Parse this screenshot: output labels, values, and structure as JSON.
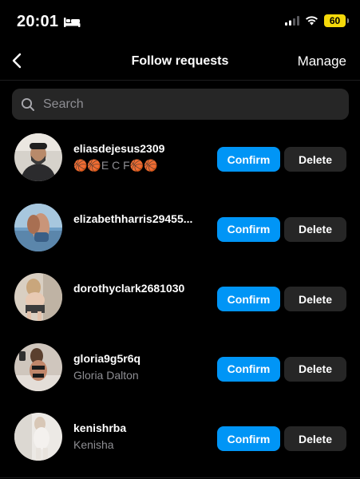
{
  "status_bar": {
    "time": "20:01",
    "battery_level": "60",
    "icons": [
      "bed-icon",
      "signal-icon",
      "wifi-icon",
      "battery-icon"
    ],
    "battery_color": "#f5d90a"
  },
  "header": {
    "back_icon": "chevron-left-icon",
    "title": "Follow requests",
    "manage_label": "Manage"
  },
  "search": {
    "placeholder": "Search",
    "value": ""
  },
  "requests": [
    {
      "username": "eliasdejesus2309",
      "subtitle": "🏀🏀E C F🏀🏀",
      "confirm_label": "Confirm",
      "delete_label": "Delete"
    },
    {
      "username": "elizabethharris29455...",
      "subtitle": "",
      "confirm_label": "Confirm",
      "delete_label": "Delete"
    },
    {
      "username": "dorothyclark2681030",
      "subtitle": "",
      "confirm_label": "Confirm",
      "delete_label": "Delete"
    },
    {
      "username": "gloria9g5r6q",
      "subtitle": "Gloria Dalton",
      "confirm_label": "Confirm",
      "delete_label": "Delete"
    },
    {
      "username": "kenishrba",
      "subtitle": "Kenisha",
      "confirm_label": "Confirm",
      "delete_label": "Delete"
    }
  ],
  "colors": {
    "background": "#000000",
    "accent": "#0095f6",
    "secondary_button": "#262626",
    "secondary_text": "#8e8e93"
  }
}
